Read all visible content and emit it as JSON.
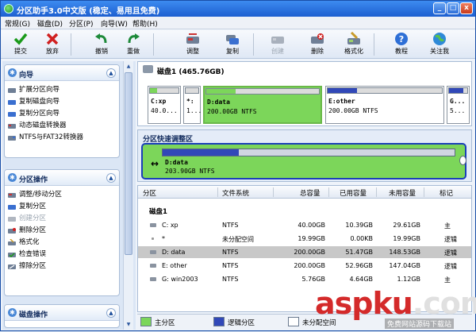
{
  "window": {
    "title": "分区助手3.0中文版 (稳定、易用且免费)",
    "controls": [
      "_",
      "□",
      "x"
    ]
  },
  "menu": [
    "常规(G)",
    "磁盘(D)",
    "分区(P)",
    "向导(W)",
    "帮助(H)"
  ],
  "toolbar": {
    "buttons": [
      {
        "label": "提交",
        "icon": "check-icon",
        "enabled": true
      },
      {
        "label": "放弃",
        "icon": "x-icon",
        "enabled": true
      },
      {
        "label": "撤销",
        "icon": "undo-icon",
        "enabled": true
      },
      {
        "label": "重做",
        "icon": "redo-icon",
        "enabled": true
      },
      {
        "label": "调整",
        "icon": "resize-disk-icon",
        "enabled": true
      },
      {
        "label": "复制",
        "icon": "copy-disk-icon",
        "enabled": true
      },
      {
        "label": "创建",
        "icon": "create-disk-icon",
        "enabled": false
      },
      {
        "label": "删除",
        "icon": "delete-disk-icon",
        "enabled": true
      },
      {
        "label": "格式化",
        "icon": "format-disk-icon",
        "enabled": true
      },
      {
        "label": "教程",
        "icon": "help-icon",
        "enabled": true
      },
      {
        "label": "关注我",
        "icon": "globe-icon",
        "enabled": true
      }
    ]
  },
  "sidebar": {
    "wizard": {
      "title": "向导",
      "items": [
        {
          "label": "扩展分区向导",
          "enabled": true
        },
        {
          "label": "复制磁盘向导",
          "enabled": true
        },
        {
          "label": "复制分区向导",
          "enabled": true
        },
        {
          "label": "动态磁盘转换器",
          "enabled": true
        },
        {
          "label": "NTFS与FAT32转换器",
          "enabled": true
        }
      ]
    },
    "partition_ops": {
      "title": "分区操作",
      "items": [
        {
          "label": "调整/移动分区",
          "enabled": true
        },
        {
          "label": "复制分区",
          "enabled": true
        },
        {
          "label": "创建分区",
          "enabled": false
        },
        {
          "label": "删除分区",
          "enabled": true
        },
        {
          "label": "格式化",
          "enabled": true
        },
        {
          "label": "检查错误",
          "enabled": true
        },
        {
          "label": "擦除分区",
          "enabled": true
        }
      ]
    },
    "disk_ops": {
      "title": "磁盘操作"
    }
  },
  "diskmap": {
    "title": "磁盘1 (465.76GB)",
    "partitions": [
      {
        "name": "C:xp",
        "size": "40.0...",
        "fill": 0.26,
        "color": "#7cd65a",
        "selected": false
      },
      {
        "name": "*:",
        "size": "1...",
        "fill": 0.0,
        "color": "#ffffff",
        "selected": false
      },
      {
        "name": "D:data",
        "size": "200.00GB NTFS",
        "fill": 0.26,
        "color": "#7cd65a",
        "selected": true
      },
      {
        "name": "E:other",
        "size": "200.00GB NTFS",
        "fill": 0.26,
        "color": "#3148b8",
        "selected": false
      },
      {
        "name": "G...",
        "size": "5...",
        "fill": 0.8,
        "color": "#3148b8",
        "selected": false
      }
    ]
  },
  "resize_panel": {
    "title": "分区快速调整区",
    "name": "D:data",
    "size": "203.90GB NTFS",
    "fill": 0.26
  },
  "table": {
    "columns": [
      "分区",
      "文件系统",
      "总容量",
      "已用容量",
      "未用容量",
      "标记"
    ],
    "group_label": "磁盘1",
    "rows": [
      {
        "partition": "C: xp",
        "fs": "NTFS",
        "total": "40.00GB",
        "used": "10.39GB",
        "free": "29.61GB",
        "flag": "主",
        "selected": false,
        "icon": "drive"
      },
      {
        "partition": "*",
        "fs": "未分配空间",
        "total": "19.99GB",
        "used": "0.00KB",
        "free": "19.99GB",
        "flag": "逻辑",
        "selected": false,
        "icon": "dot"
      },
      {
        "partition": "D: data",
        "fs": "NTFS",
        "total": "200.00GB",
        "used": "51.47GB",
        "free": "148.53GB",
        "flag": "逻辑",
        "selected": true,
        "icon": "drive"
      },
      {
        "partition": "E: other",
        "fs": "NTFS",
        "total": "200.00GB",
        "used": "52.96GB",
        "free": "147.04GB",
        "flag": "逻辑",
        "selected": false,
        "icon": "drive"
      },
      {
        "partition": "G: win2003",
        "fs": "NTFS",
        "total": "5.76GB",
        "used": "4.64GB",
        "free": "1.12GB",
        "flag": "主",
        "selected": false,
        "icon": "drive"
      }
    ]
  },
  "legend": [
    {
      "label": "主分区",
      "color": "#7cd65a"
    },
    {
      "label": "逻辑分区",
      "color": "#3148b8"
    },
    {
      "label": "未分配空间",
      "color": "#ffffff"
    }
  ],
  "watermark": {
    "main": "aspku",
    "suffix": ".com",
    "sub": "免费网站源码下载站"
  }
}
